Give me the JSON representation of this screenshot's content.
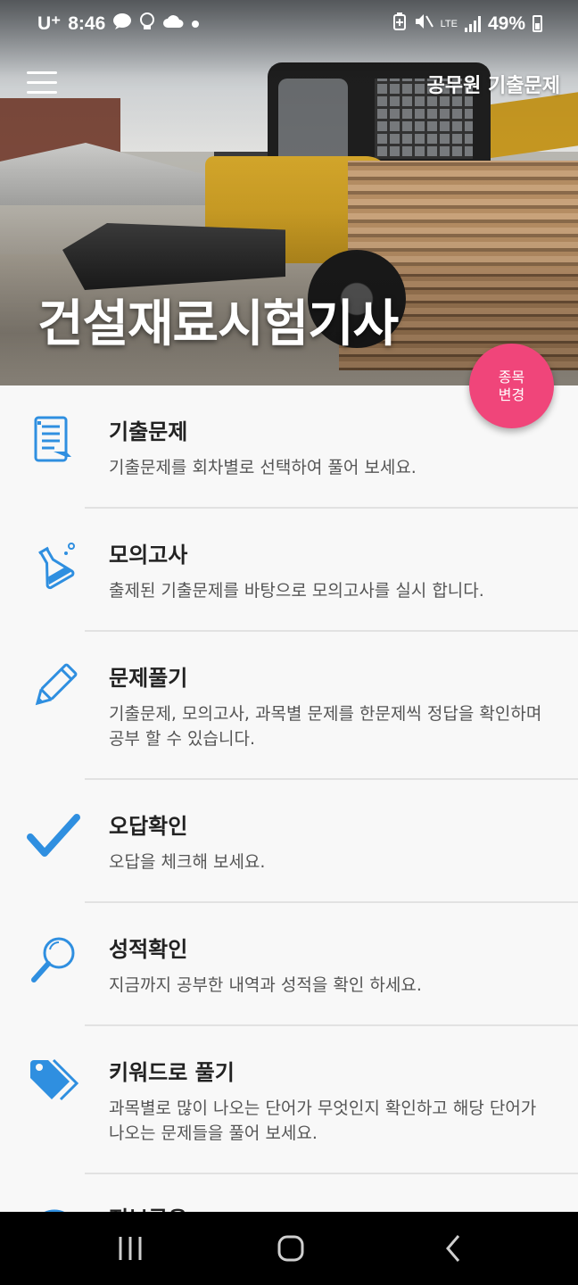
{
  "status_bar": {
    "carrier": "U⁺",
    "time": "8:46",
    "battery": "49%",
    "network": "LTE"
  },
  "app_bar": {
    "link_label": "공무원 기출문제"
  },
  "hero": {
    "title": "건설재료시험기사"
  },
  "fab": {
    "line1": "종목",
    "line2": "변경"
  },
  "menu": [
    {
      "icon": "notebook-icon",
      "title": "기출문제",
      "desc": "기출문제를 회차별로 선택하여 풀어 보세요."
    },
    {
      "icon": "flask-icon",
      "title": "모의고사",
      "desc": "출제된 기출문제를 바탕으로 모의고사를 실시 합니다."
    },
    {
      "icon": "pencil-icon",
      "title": "문제풀기",
      "desc": "기출문제, 모의고사, 과목별 문제를 한문제씩 정답을 확인하며 공부 할 수 있습니다."
    },
    {
      "icon": "checkmark-icon",
      "title": "오답확인",
      "desc": "오답을 체크해 보세요."
    },
    {
      "icon": "magnifier-icon",
      "title": "성적확인",
      "desc": "지금까지 공부한 내역과 성적을 확인 하세요."
    },
    {
      "icon": "tag-icon",
      "title": "키워드로 풀기",
      "desc": "과목별로 많이 나오는 단어가 무엇인지 확인하고 해당 단어가 나오는 문제들을 풀어 보세요."
    },
    {
      "icon": "globe-icon",
      "title": "정보공유",
      "desc": ""
    }
  ],
  "colors": {
    "accent": "#2f8fe0",
    "fab": "#f0457a"
  }
}
